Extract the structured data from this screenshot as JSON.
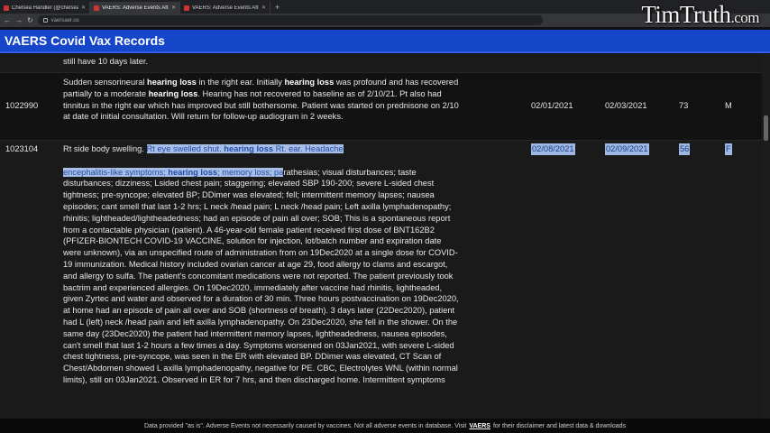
{
  "browser": {
    "tabs": [
      {
        "label": "Chelsea Handler (@chelseahandler)"
      },
      {
        "label": "VAERS: Adverse Events After Covid..."
      },
      {
        "label": "VAERS: Adverse Events After Covid..."
      }
    ],
    "new_tab": "+",
    "url": "vaersaer.us"
  },
  "brand": {
    "name": "TimTruth",
    "tld": ".com"
  },
  "page": {
    "title": "VAERS Covid Vax Records"
  },
  "rows": [
    {
      "desc_tail": "still have 10 days later."
    },
    {
      "id": "1022990",
      "date1": "02/01/2021",
      "date2": "02/03/2021",
      "age": "73",
      "sex": "M",
      "desc": {
        "p1": "Sudden sensorineural ",
        "b1": "hearing loss",
        "p2": " in the right ear. Initially ",
        "b2": "hearing loss",
        "p3": " was profound and has recovered partially to a moderate ",
        "b3": "hearing loss",
        "p4": ". Hearing has not recovered to baseline as of 2/10/21. Pt also had tinnitus in the right ear which has improved but still bothersome. Patient was started on prednisone on 2/10 at date of initial consultation. Will return for follow-up audiogram in 2 weeks."
      }
    },
    {
      "id": "1023104",
      "date1": "02/08/2021",
      "date2": "02/09/2021",
      "age": "56",
      "sex": "F",
      "desc": {
        "p1": "Rt side body swelling. ",
        "h1": "Rt eye swelled shut. ",
        "hb1": "hearing loss",
        "h2": " Rt. ear. Headache",
        "h3": "encephalitis-like symptoms; ",
        "hb2": "hearing loss",
        "h4": "; memory loss; pa",
        "p2": "rathesias; visual disturbances; taste disturbances; dizziness; Lsided chest pain; staggering; elevated SBP 190-200; severe L-sided chest tightness; pre-syncope; elevated BP; DDimer was elevated; fell; intermittent memory lapses; nausea episodes; cant smell that last 1-2 hrs; L neck /head pain; L neck /head pain; Left axilla lymphadenopathy; rhinitis; lightheaded/lightheadedness; had an episode of pain all over; SOB; This is a spontaneous report from a contactable physician (patient). A 46-year-old female patient received first dose of BNT162B2 (PFIZER-BIONTECH COVID-19 VACCINE, solution for injection, lot/batch number and expiration date were unknown), via an unspecified route of administration from on 19Dec2020 at a single dose for COVID-19 immunization. Medical history included ovarian cancer at age 29, food allergy to clams and escargot, and allergy to sulfa. The patient's concomitant medications were not reported. The patient previously took bactrim and experienced allergies. On 19Dec2020, immediately after vaccine had rhinitis, lightheaded, given Zyrtec and water and observed for a duration of 30 min. Three hours postvaccination on 19Dec2020, at home had an episode of pain all over and SOB (shortness of breath). 3 days later (22Dec2020), patient had L (left) neck /head pain and left axilla lymphadenopathy. On 23Dec2020, she fell in the shower. On the same day (23Dec2020) the patient had intermittent memory lapses, lightheadedness, nausea episodes, can't smell that last 1-2 hours a few times a day. Symptoms worsened on 03Jan2021, with severe L-sided chest tightness, pre-syncope, was seen in the ER with elevated BP. DDimer was elevated, CT Scan of Chest/Abdomen showed L axilla lymphadenopathy, negative for PE. CBC, Electrolytes WNL (within normal limits), still on 03Jan2021. Observed in ER for 7 hrs, and then discharged home. Intermittent symptoms"
      }
    }
  ],
  "footer": {
    "pre": "Data provided \"as is\". Adverse Events not necessarily caused by vaccines. Not all adverse events in database. Visit ",
    "link": "VAERS",
    "post": " for their disclaimer and latest data & downloads"
  }
}
